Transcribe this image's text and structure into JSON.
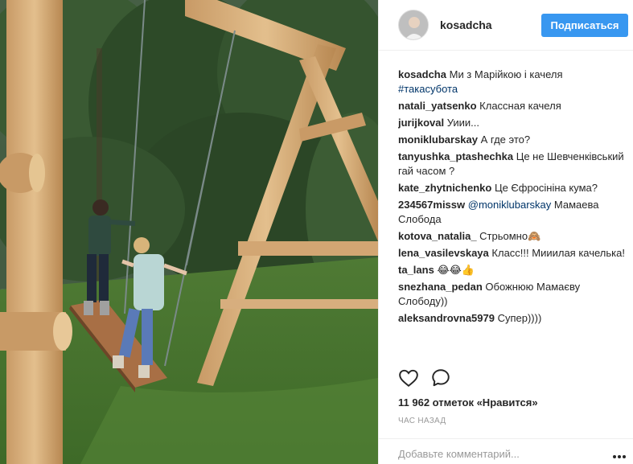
{
  "header": {
    "username": "kosadcha",
    "follow_label": "Подписаться"
  },
  "comments": [
    {
      "user": "kosadcha",
      "text": "Ми з Марійкою і качеля",
      "tag": "#такасубота"
    },
    {
      "user": "natali_yatsenko",
      "text": "Классная качеля"
    },
    {
      "user": "jurijkoval",
      "text": "Уиии..."
    },
    {
      "user": "moniklubarskay",
      "text": "А где это?"
    },
    {
      "user": "tanyushka_ptashechka",
      "text": "Це не Шевченківський гай часом ?"
    },
    {
      "user": "kate_zhytnichenko",
      "text": "Це Єфросініна кума?"
    },
    {
      "user": "234567missw",
      "mention": "@moniklubarskay",
      "text": "Мамаева Слобода"
    },
    {
      "user": "kotova_natalia_",
      "text": "Стрьомно🙈"
    },
    {
      "user": "lena_vasilevskaya",
      "text": "Класс!!! Мииилая качелька!"
    },
    {
      "user": "ta_lans",
      "text": "😂😂👍"
    },
    {
      "user": "snezhana_pedan",
      "text": "Обожнюю Мамаєву Слободу))"
    },
    {
      "user": "aleksandrovna5979",
      "text": "Супер))))"
    }
  ],
  "actions": {
    "like_icon": "heart-icon",
    "comment_icon": "comment-bubble-icon"
  },
  "likes_text": "11 962 отметок «Нравится»",
  "time_text": "час назад",
  "add_comment_placeholder": "Добавьте комментарий...",
  "more_icon": "more-options-icon",
  "colors": {
    "follow_button": "#3897f0",
    "link": "#003569",
    "muted": "#999999"
  }
}
